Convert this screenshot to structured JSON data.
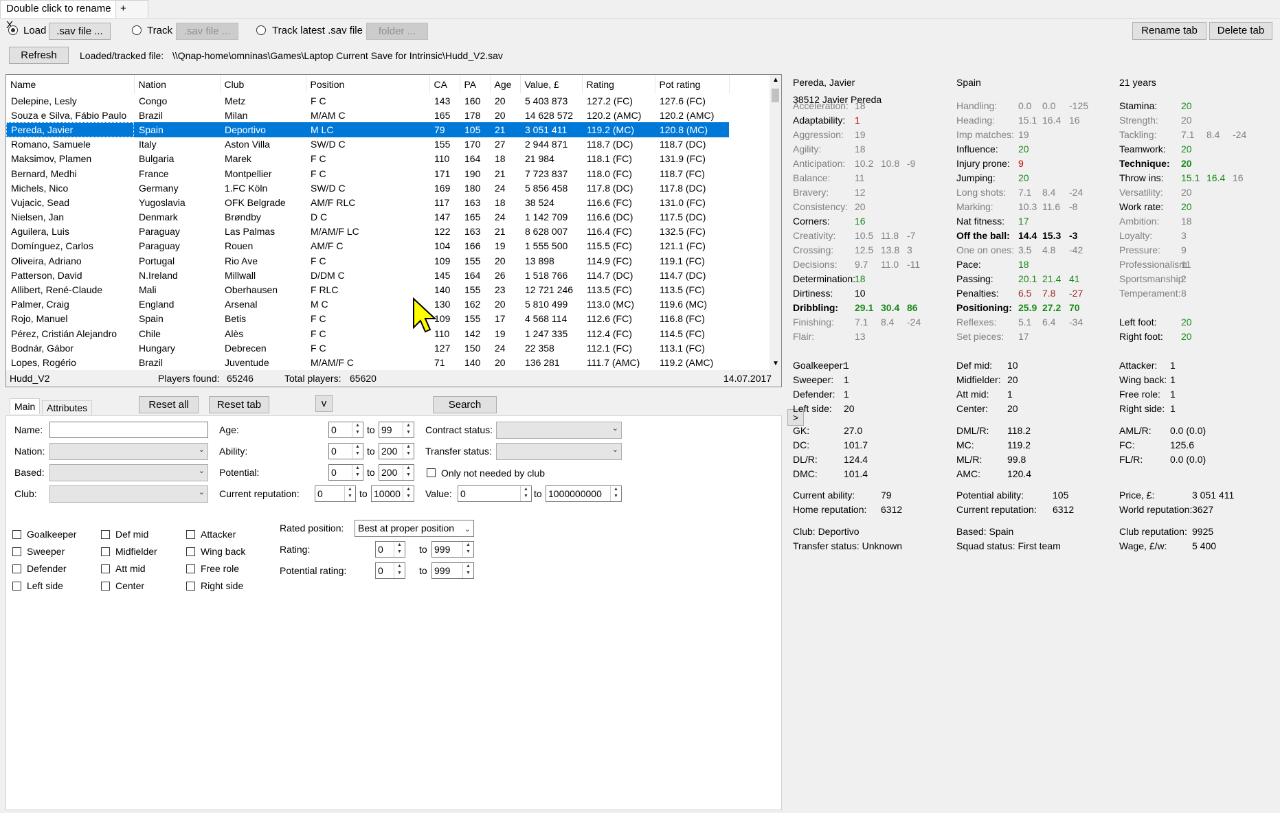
{
  "tabs": {
    "active": "Double click to rename X",
    "add": "+"
  },
  "toolbar": {
    "load_label": "Load",
    "sav_file_button": ".sav file ...",
    "track_label": "Track",
    "track_sav_button": ".sav file ...",
    "track_latest_label": "Track latest .sav file in",
    "folder_button": "folder ...",
    "rename_tab": "Rename tab",
    "delete_tab": "Delete tab",
    "refresh": "Refresh",
    "loaded_label": "Loaded/tracked file:",
    "loaded_path": "\\\\Qnap-home\\omninas\\Games\\Laptop Current Save for Intrinsic\\Hudd_V2.sav"
  },
  "grid": {
    "columns": [
      "Name",
      "Nation",
      "Club",
      "Position",
      "CA",
      "PA",
      "Age",
      "Value, £",
      "Rating",
      "Pot rating"
    ],
    "rows": [
      [
        "Delepine, Lesly",
        "Congo",
        "Metz",
        "F C",
        "143",
        "160",
        "20",
        "5 403 873",
        "127.2 (FC)",
        "127.6 (FC)"
      ],
      [
        "Souza e Silva, Fábio Paulo",
        "Brazil",
        "Milan",
        "M/AM C",
        "165",
        "178",
        "20",
        "14 628 572",
        "120.2 (AMC)",
        "120.2 (AMC)"
      ],
      [
        "Pereda, Javier",
        "Spain",
        "Deportivo",
        "M LC",
        "79",
        "105",
        "21",
        "3 051 411",
        "119.2 (MC)",
        "120.8 (MC)"
      ],
      [
        "Romano, Samuele",
        "Italy",
        "Aston Villa",
        "SW/D C",
        "155",
        "170",
        "27",
        "2 944 871",
        "118.7 (DC)",
        "118.7 (DC)"
      ],
      [
        "Maksimov, Plamen",
        "Bulgaria",
        "Marek",
        "F C",
        "110",
        "164",
        "18",
        "21 984",
        "118.1 (FC)",
        "131.9 (FC)"
      ],
      [
        "Bernard, Medhi",
        "France",
        "Montpellier",
        "F C",
        "171",
        "190",
        "21",
        "7 723 837",
        "118.0 (FC)",
        "118.7 (FC)"
      ],
      [
        "Michels, Nico",
        "Germany",
        "1.FC Köln",
        "SW/D C",
        "169",
        "180",
        "24",
        "5 856 458",
        "117.8 (DC)",
        "117.8 (DC)"
      ],
      [
        "Vujacic, Sead",
        "Yugoslavia",
        "OFK Belgrade",
        "AM/F RLC",
        "117",
        "163",
        "18",
        "38 524",
        "116.6 (FC)",
        "131.0 (FC)"
      ],
      [
        "Nielsen, Jan",
        "Denmark",
        "Brøndby",
        "D C",
        "147",
        "165",
        "24",
        "1 142 709",
        "116.6 (DC)",
        "117.5 (DC)"
      ],
      [
        "Aguilera, Luis",
        "Paraguay",
        "Las Palmas",
        "M/AM/F LC",
        "122",
        "163",
        "21",
        "8 628 007",
        "116.4 (FC)",
        "132.5 (FC)"
      ],
      [
        "Domínguez, Carlos",
        "Paraguay",
        "Rouen",
        "AM/F C",
        "104",
        "166",
        "19",
        "1 555 500",
        "115.5 (FC)",
        "121.1 (FC)"
      ],
      [
        "Oliveira, Adriano",
        "Portugal",
        "Rio Ave",
        "F C",
        "109",
        "155",
        "20",
        "13 898",
        "114.9 (FC)",
        "119.1 (FC)"
      ],
      [
        "Patterson, David",
        "N.Ireland",
        "Millwall",
        "D/DM C",
        "145",
        "164",
        "26",
        "1 518 766",
        "114.7 (DC)",
        "114.7 (DC)"
      ],
      [
        "Allibert, René-Claude",
        "Mali",
        "Oberhausen",
        "F RLC",
        "140",
        "155",
        "23",
        "12 721 246",
        "113.5 (FC)",
        "113.5 (FC)"
      ],
      [
        "Palmer, Craig",
        "England",
        "Arsenal",
        "M C",
        "130",
        "162",
        "20",
        "5 810 499",
        "113.0 (MC)",
        "119.6 (MC)"
      ],
      [
        "Rojo, Manuel",
        "Spain",
        "Betis",
        "F C",
        "109",
        "155",
        "17",
        "4 568 114",
        "112.6 (FC)",
        "116.8 (FC)"
      ],
      [
        "Pérez, Cristián Alejandro",
        "Chile",
        "Alès",
        "F C",
        "110",
        "142",
        "19",
        "1 247 335",
        "112.4 (FC)",
        "114.5 (FC)"
      ],
      [
        "Bodnár, Gábor",
        "Hungary",
        "Debrecen",
        "F C",
        "127",
        "150",
        "24",
        "22 358",
        "112.1 (FC)",
        "113.1 (FC)"
      ],
      [
        "Lopes, Rogério",
        "Brazil",
        "Juventude",
        "M/AM/F C",
        "71",
        "140",
        "20",
        "136 281",
        "111.7 (AMC)",
        "119.2 (AMC)"
      ]
    ],
    "selected_index": 2
  },
  "status": {
    "save": "Hudd_V2",
    "found_label": "Players found:",
    "found": "65246",
    "total_label": "Total players:",
    "total": "65620",
    "date": "14.07.2017"
  },
  "filter": {
    "tab_main": "Main",
    "tab_attributes": "Attributes",
    "reset_all": "Reset all",
    "reset_tab": "Reset tab",
    "v": "v",
    "search": "Search",
    "name": "Name:",
    "nation": "Nation:",
    "based": "Based:",
    "club": "Club:",
    "age": "Age:",
    "age_from": "0",
    "age_to": "99",
    "ability": "Ability:",
    "ability_from": "0",
    "ability_to": "200",
    "potential": "Potential:",
    "potential_from": "0",
    "potential_to": "200",
    "cur_rep": "Current reputation:",
    "cur_rep_from": "0",
    "cur_rep_to": "10000",
    "to": "to",
    "contract": "Contract status:",
    "transfer": "Transfer status:",
    "only_not_needed": "Only not needed by club",
    "value": "Value:",
    "value_from": "0",
    "value_to": "1000000000",
    "positions": [
      "Goalkeeper",
      "Sweeper",
      "Defender",
      "Left side",
      "Def mid",
      "Midfielder",
      "Att mid",
      "Center",
      "Attacker",
      "Wing back",
      "Free role",
      "Right side"
    ],
    "rated_position": "Rated position:",
    "rated_value": "Best at proper position",
    "rating": "Rating:",
    "rating_from": "0",
    "rating_to": "999",
    "pot_rating": "Potential rating:",
    "pot_rating_from": "0",
    "pot_rating_to": "999"
  },
  "detail": {
    "name": "Pereda, Javier",
    "nation": "Spain",
    "age": "21 years",
    "id_name": "38512 Javier Pereda",
    "expand": ">",
    "col1": [
      [
        "Acceleration:",
        "18",
        "",
        "",
        ""
      ],
      [
        "Adaptability:",
        "1",
        "",
        "",
        ""
      ],
      [
        "Aggression:",
        "19",
        "",
        "",
        ""
      ],
      [
        "Agility:",
        "18",
        "",
        "",
        ""
      ],
      [
        "Anticipation:",
        "10.2",
        "10.8",
        "-9",
        ""
      ],
      [
        "Balance:",
        "11",
        "",
        "",
        ""
      ],
      [
        "Bravery:",
        "12",
        "",
        "",
        ""
      ],
      [
        "Consistency:",
        "20",
        "",
        "",
        ""
      ],
      [
        "Corners:",
        "16",
        "",
        "",
        ""
      ],
      [
        "Creativity:",
        "10.5",
        "11.8",
        "-7",
        ""
      ],
      [
        "Crossing:",
        "12.5",
        "13.8",
        "3",
        ""
      ],
      [
        "Decisions:",
        "9.7",
        "11.0",
        "-11",
        ""
      ],
      [
        "Determination:",
        "18",
        "",
        "",
        ""
      ],
      [
        "Dirtiness:",
        "10",
        "",
        "",
        ""
      ],
      [
        "Dribbling:",
        "29.1",
        "30.4",
        "86",
        ""
      ],
      [
        "Finishing:",
        "7.1",
        "8.4",
        "-24",
        ""
      ],
      [
        "Flair:",
        "13",
        "",
        "",
        ""
      ]
    ],
    "col2": [
      [
        "Handling:",
        "0.0",
        "0.0",
        "-125"
      ],
      [
        "Heading:",
        "15.1",
        "16.4",
        "16"
      ],
      [
        "Imp matches:",
        "19",
        "",
        ""
      ],
      [
        "Influence:",
        "20",
        "",
        ""
      ],
      [
        "Injury prone:",
        "9",
        "",
        ""
      ],
      [
        "Jumping:",
        "20",
        "",
        ""
      ],
      [
        "Long shots:",
        "7.1",
        "8.4",
        "-24"
      ],
      [
        "Marking:",
        "10.3",
        "11.6",
        "-8"
      ],
      [
        "Nat fitness:",
        "17",
        "",
        ""
      ],
      [
        "Off the ball:",
        "14.4",
        "15.3",
        "-3"
      ],
      [
        "One on ones:",
        "3.5",
        "4.8",
        "-42"
      ],
      [
        "Pace:",
        "18",
        "",
        ""
      ],
      [
        "Passing:",
        "20.1",
        "21.4",
        "41"
      ],
      [
        "Penalties:",
        "6.5",
        "7.8",
        "-27"
      ],
      [
        "Positioning:",
        "25.9",
        "27.2",
        "70"
      ],
      [
        "Reflexes:",
        "5.1",
        "6.4",
        "-34"
      ],
      [
        "Set pieces:",
        "17",
        "",
        ""
      ]
    ],
    "col3": [
      [
        "Stamina:",
        "20",
        "",
        ""
      ],
      [
        "Strength:",
        "20",
        "",
        ""
      ],
      [
        "Tackling:",
        "7.1",
        "8.4",
        "-24"
      ],
      [
        "Teamwork:",
        "20",
        "",
        ""
      ],
      [
        "Technique:",
        "20",
        "",
        ""
      ],
      [
        "Throw ins:",
        "15.1",
        "16.4",
        "16"
      ],
      [
        "Versatility:",
        "20",
        "",
        ""
      ],
      [
        "Work rate:",
        "20",
        "",
        ""
      ],
      [
        "Ambition:",
        "18",
        "",
        ""
      ],
      [
        "Loyalty:",
        "3",
        "",
        ""
      ],
      [
        "Pressure:",
        "9",
        "",
        ""
      ],
      [
        "Professionalism:",
        "11",
        "",
        ""
      ],
      [
        "Sportsmanship:",
        "2",
        "",
        ""
      ],
      [
        "Temperament:",
        "8",
        "",
        ""
      ],
      [
        "",
        ""
      ],
      [
        "Left foot:",
        "20",
        "",
        ""
      ],
      [
        "Right foot:",
        "20",
        "",
        ""
      ]
    ],
    "pos": [
      [
        "Goalkeeper:",
        "1",
        "Def mid:",
        "10",
        "Attacker:",
        "1"
      ],
      [
        "Sweeper:",
        "1",
        "Midfielder:",
        "20",
        "Wing back:",
        "1"
      ],
      [
        "Defender:",
        "1",
        "Att mid:",
        "1",
        "Free role:",
        "1"
      ],
      [
        "Left side:",
        "20",
        "Center:",
        "20",
        "Right side:",
        "1"
      ]
    ],
    "ratings": [
      [
        "GK:",
        "27.0",
        "DML/R:",
        "118.2",
        "AML/R:",
        "0.0 (0.0)"
      ],
      [
        "DC:",
        "101.7",
        "MC:",
        "119.2",
        "FC:",
        "125.6"
      ],
      [
        "DL/R:",
        "124.4",
        "ML/R:",
        "99.8",
        "FL/R:",
        "0.0 (0.0)"
      ],
      [
        "DMC:",
        "101.4",
        "AMC:",
        "120.4",
        "",
        ""
      ]
    ],
    "info": [
      [
        "Current ability:",
        "79",
        "Potential ability:",
        "105",
        "Price, £:",
        "3 051 411"
      ],
      [
        "Home reputation:",
        "6312",
        "Current reputation:",
        "6312",
        "World reputation:",
        "3627"
      ]
    ],
    "club": [
      [
        "Club: Deportivo",
        "Based: Spain",
        "Club reputation:",
        "9925"
      ],
      [
        "Transfer status:  Unknown",
        "Squad status:  First team",
        "Wage, £/w:",
        "5 400"
      ]
    ]
  }
}
